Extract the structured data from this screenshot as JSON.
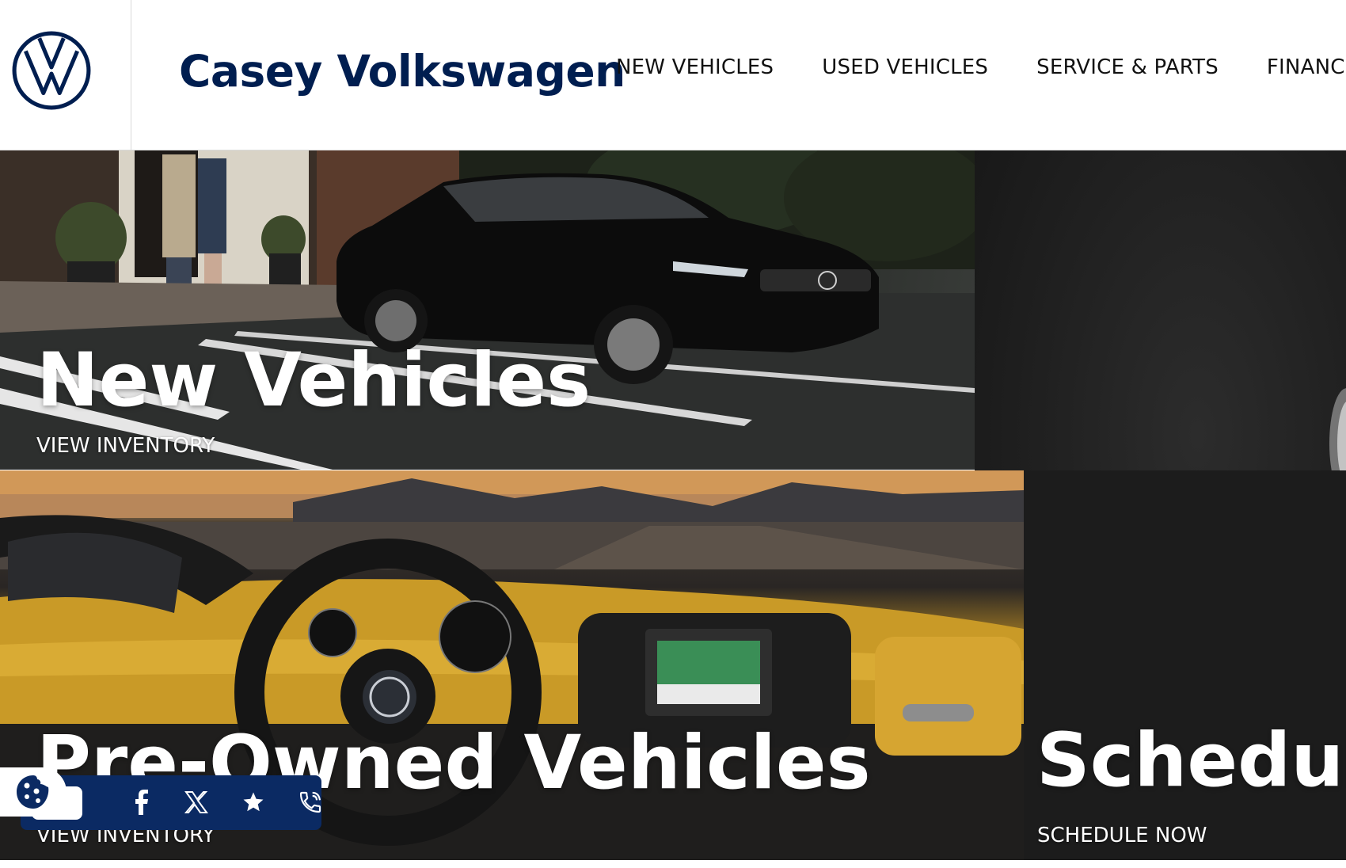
{
  "header": {
    "logo": "volkswagen-logo",
    "brand": "Casey Volkswagen",
    "nav": [
      "NEW VEHICLES",
      "USED VEHICLES",
      "SERVICE & PARTS",
      "FINANCE"
    ]
  },
  "tiles": {
    "new": {
      "title": "New Vehicles",
      "link": "VIEW INVENTORY"
    },
    "used": {
      "title": "Pre-Owned Vehicles",
      "link": "VIEW INVENTORY"
    },
    "service": {
      "title": "Schedul",
      "link": "SCHEDULE NOW"
    }
  },
  "social": {
    "icons": [
      "cookie-icon",
      "facebook-icon",
      "x-icon",
      "star-icon",
      "phone-icon"
    ]
  },
  "colors": {
    "brand_navy": "#001e50",
    "social_bar": "#0b2a63"
  }
}
